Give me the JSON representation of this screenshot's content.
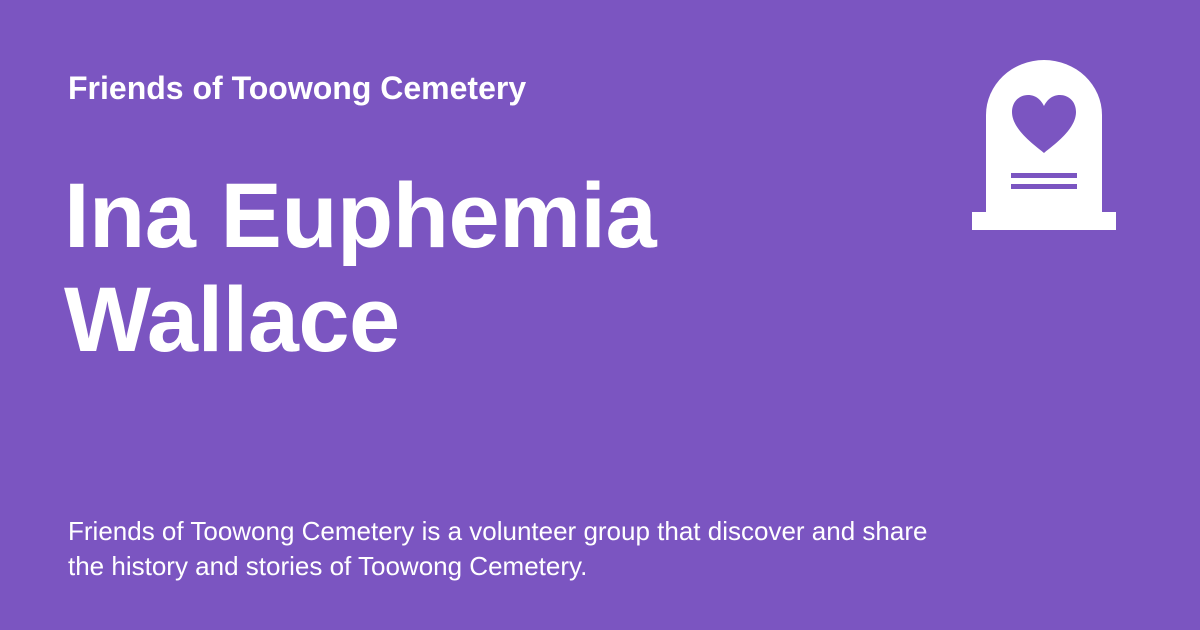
{
  "header": {
    "organization": "Friends of Toowong Cemetery"
  },
  "main": {
    "person_name": "Ina Euphemia Wallace"
  },
  "footer": {
    "description": "Friends of Toowong Cemetery is a volunteer group that discover and share the history and stories of Toowong Cemetery."
  },
  "logo": {
    "icon": "headstone-heart-icon"
  },
  "colors": {
    "background": "#7b55c1",
    "text": "#ffffff",
    "icon": "#ffffff"
  }
}
